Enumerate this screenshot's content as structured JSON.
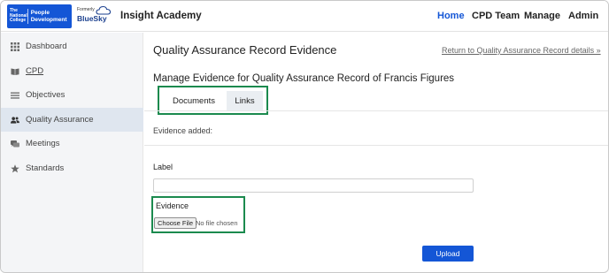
{
  "brand": {
    "logo_left": "The National College",
    "logo_right": "People Development",
    "formerly": "Formerly",
    "bluesky": "BlueSky",
    "title": "Insight Academy"
  },
  "nav": {
    "home": "Home",
    "cpd_team": "CPD Team",
    "manage": "Manage",
    "admin": "Admin",
    "active": "Home",
    "accent": "#1456d6"
  },
  "sidebar": {
    "items": [
      {
        "label": "Dashboard",
        "icon": "grid-icon"
      },
      {
        "label": "CPD",
        "icon": "book-icon"
      },
      {
        "label": "Objectives",
        "icon": "list-icon"
      },
      {
        "label": "Quality Assurance",
        "icon": "users-icon",
        "active": true
      },
      {
        "label": "Meetings",
        "icon": "chat-icon"
      },
      {
        "label": "Standards",
        "icon": "star-icon"
      }
    ]
  },
  "main": {
    "page_title": "Quality Assurance Record Evidence",
    "return_link": "Return to Quality Assurance Record details »",
    "sub_title": "Manage Evidence for Quality Assurance Record of Francis Figures",
    "tabs": [
      "Documents",
      "Links"
    ],
    "evidence_added": "Evidence added:",
    "label_field_label": "Label",
    "label_field_value": "",
    "evidence_label": "Evidence",
    "choose_file": "Choose File",
    "no_file": "No file chosen",
    "upload": "Upload",
    "highlight_color": "#1b8a4e"
  }
}
